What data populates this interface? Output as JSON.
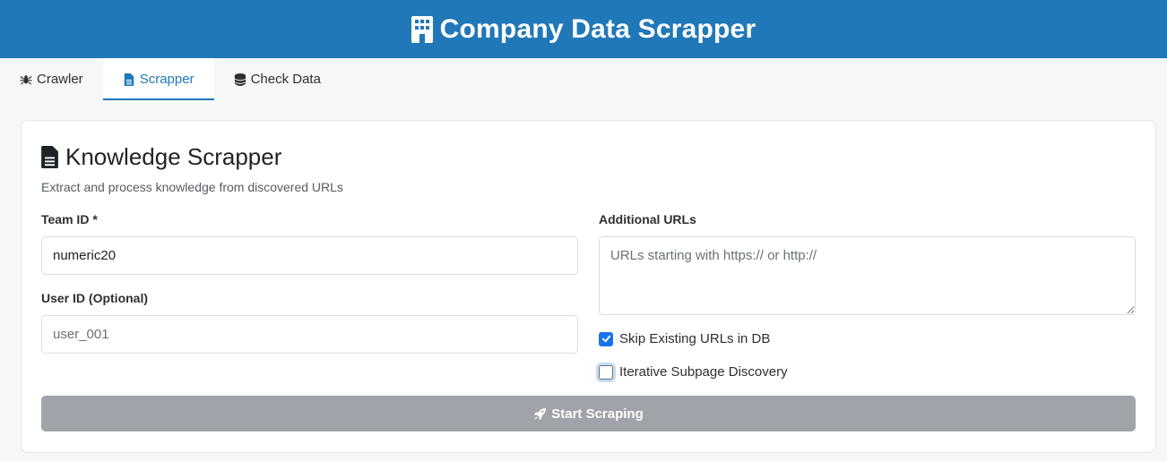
{
  "header": {
    "title": "Company Data Scrapper",
    "icon": "building-icon"
  },
  "tabs": [
    {
      "label": "Crawler",
      "icon": "spider-icon",
      "active": false
    },
    {
      "label": "Scrapper",
      "icon": "file-icon",
      "active": true
    },
    {
      "label": "Check Data",
      "icon": "database-icon",
      "active": false
    }
  ],
  "card": {
    "title": "Knowledge Scrapper",
    "subtitle": "Extract and process knowledge from discovered URLs"
  },
  "form": {
    "team_id": {
      "label": "Team ID *",
      "value": "numeric20"
    },
    "user_id": {
      "label": "User ID (Optional)",
      "placeholder": "user_001"
    },
    "additional_urls": {
      "label": "Additional URLs",
      "placeholder": "URLs starting with https:// or http://"
    },
    "skip_existing": {
      "label": "Skip Existing URLs in DB",
      "checked": true
    },
    "iterative_discovery": {
      "label": "Iterative Subpage Discovery",
      "checked": false
    },
    "submit": {
      "label": "Start Scraping",
      "icon": "rocket-icon"
    }
  },
  "colors": {
    "brand": "#2078b8",
    "checkbox": "#1a73e8",
    "button_disabled": "#a0a3a9"
  }
}
